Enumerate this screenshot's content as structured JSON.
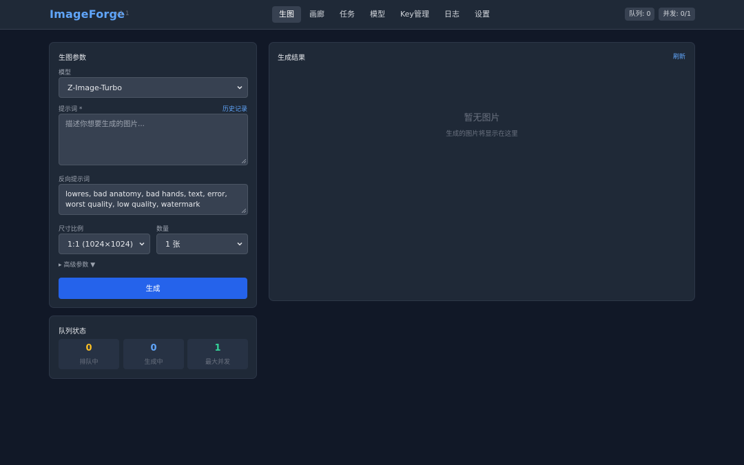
{
  "header": {
    "logo": "ImageForge",
    "version": "v1.1",
    "nav": [
      {
        "label": "生图",
        "active": true
      },
      {
        "label": "画廊",
        "active": false
      },
      {
        "label": "任务",
        "active": false
      },
      {
        "label": "模型",
        "active": false
      },
      {
        "label": "Key管理",
        "active": false
      },
      {
        "label": "日志",
        "active": false
      },
      {
        "label": "设置",
        "active": false
      }
    ],
    "queue_badge": "队列: 0",
    "concurrency_badge": "并发: 0/1"
  },
  "params": {
    "title": "生图参数",
    "model_label": "模型",
    "model_value": "Z-Image-Turbo",
    "prompt_label": "提示词 *",
    "history_link": "历史记录",
    "prompt_placeholder": "描述你想要生成的图片...",
    "negative_label": "反向提示词",
    "negative_value": "lowres, bad anatomy, bad hands, text, error, worst quality, low quality, watermark",
    "ratio_label": "尺寸比例",
    "ratio_value": "1:1 (1024×1024)",
    "count_label": "数量",
    "count_value": "1 张",
    "advanced_toggle": "▸ 高级参数 ▼",
    "generate_button": "生成"
  },
  "queue": {
    "title": "队列状态",
    "stats": [
      {
        "value": "0",
        "label": "排队中",
        "color": "#fbbf24"
      },
      {
        "value": "0",
        "label": "生成中",
        "color": "#60a5fa"
      },
      {
        "value": "1",
        "label": "最大并发",
        "color": "#34d399"
      }
    ]
  },
  "results": {
    "title": "生成结果",
    "refresh_link": "刷新",
    "empty_title": "暂无图片",
    "empty_subtitle": "生成的图片将显示在这里"
  },
  "colors": {
    "accent": "#2563eb",
    "link": "#60a5fa",
    "background": "#111827",
    "panel": "#1f2937"
  }
}
